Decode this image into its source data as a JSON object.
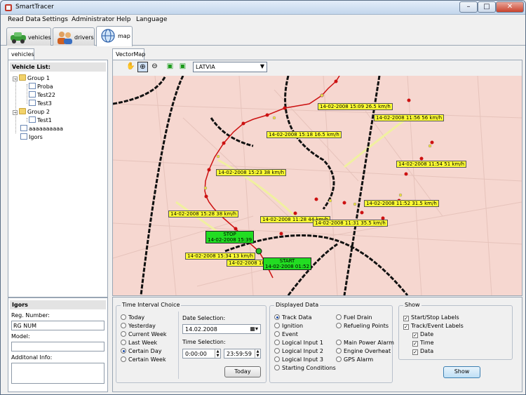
{
  "window": {
    "title": "SmartTracer"
  },
  "menu": [
    "Read Data",
    "Settings",
    "Administrator",
    "Help",
    "Language"
  ],
  "app_tabs": [
    {
      "label": "vehicles",
      "icon": "car-icon"
    },
    {
      "label": "drivers",
      "icon": "people-icon"
    },
    {
      "label": "map",
      "icon": "globe-icon",
      "active": true
    }
  ],
  "left": {
    "tab": "vehicles",
    "header": "Vehicle List:",
    "tree": [
      {
        "label": "Group 1",
        "type": "folder"
      },
      {
        "label": "Proba",
        "type": "item"
      },
      {
        "label": "Test22",
        "type": "item"
      },
      {
        "label": "Test3",
        "type": "item"
      },
      {
        "label": "Group 2",
        "type": "folder"
      },
      {
        "label": "Test1",
        "type": "item"
      },
      {
        "label": "aaaaaaaaaa",
        "type": "item"
      },
      {
        "label": "Igors",
        "type": "item"
      }
    ]
  },
  "info": {
    "header": "Igors",
    "reg_label": "Reg. Number:",
    "reg_value": "RG NUM",
    "model_label": "Model:",
    "model_value": "",
    "addinfo_label": "Additonal Info:",
    "addinfo_value": ""
  },
  "map": {
    "tab": "VectorMap",
    "region": "LATVIA",
    "labels": [
      "14-02-2008 15:09 26.5 km/h",
      "14-02-2008 11:56 56 km/h",
      "14-02-2008 15:18 16.5 km/h",
      "14-02-2008 11:54 51 km/h",
      "14-02-2008 15:23 38 km/h",
      "14-02-2008 11:52 31.5 km/h",
      "14-02-2008 15:28 38 km/h",
      "14-02-2008 11:28 44 km/h",
      "14-02-2008 11:31 35.5 km/h",
      "14-02-2008 15:34 13 km/h",
      "14-02-2008 10"
    ],
    "stop": {
      "title": "STOP",
      "time": "14-02-2008 15:39"
    },
    "start": {
      "title": "START",
      "time": "14-02-2008 01:52"
    }
  },
  "time_interval": {
    "title": "Time Interval Choice",
    "options": [
      "Today",
      "Yesterday",
      "Current Week",
      "Last Week",
      "Certain Day",
      "Certain Week"
    ],
    "selected": "Certain Day",
    "date_label": "Date Selection:",
    "date_value": "14.02.2008",
    "time_label": "Time Selection:",
    "time_from": "0:00:00",
    "time_to": "23:59:59",
    "today_button": "Today"
  },
  "displayed_data": {
    "title": "Displayed Data",
    "col1": [
      "Track Data",
      "Ignition",
      "Event",
      "Logical Input 1",
      "Logical Input 2",
      "Logical Input 3",
      "Starting Conditions"
    ],
    "col2": [
      "Fuel Drain",
      "Refueling Points",
      "",
      "Main Power Alarm",
      "Engine Overheat",
      "GPS Alarm"
    ],
    "selected": "Track Data"
  },
  "show": {
    "title": "Show",
    "items": [
      "Start/Stop Labels",
      "Track/Event Labels",
      "Date",
      "Time",
      "Data"
    ],
    "button": "Show"
  },
  "colors": {
    "map_bg": "#f6d7d0",
    "track": "#cc1111",
    "label_bg": "#ffff33",
    "startstop_bg": "#22dd22"
  }
}
